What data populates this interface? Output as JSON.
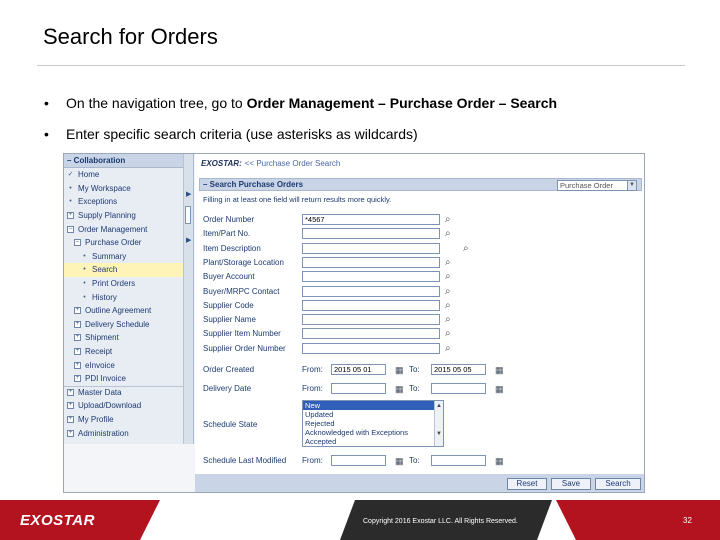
{
  "slide": {
    "title": "Search for Orders",
    "bullets": [
      {
        "plain": "On the navigation tree, go to ",
        "bold": "Order Management – Purchase Order – Search"
      },
      {
        "plain": "Enter specific search criteria (use asterisks as wildcards)",
        "bold": ""
      }
    ],
    "bullet_glyph": "•"
  },
  "nav": {
    "header": "– Collaboration",
    "items": [
      {
        "label": "Home",
        "icon": "check-icon",
        "glyph": "✓",
        "selected": false
      },
      {
        "label": "My Workspace",
        "icon": "dot-icon",
        "glyph": "•",
        "selected": false
      },
      {
        "label": "Exceptions",
        "icon": "dot-icon",
        "glyph": "•",
        "selected": false
      },
      {
        "label": "Supply Planning",
        "icon": "expand-icon",
        "glyph": "+",
        "selected": false
      },
      {
        "label": "Order Management",
        "icon": "collapse-icon",
        "glyph": "–",
        "selected": false
      },
      {
        "label": "Purchase Order",
        "icon": "collapse-icon",
        "glyph": "–",
        "selected": false,
        "indent": 1
      },
      {
        "label": "Summary",
        "icon": "dot-icon",
        "glyph": "•",
        "selected": false,
        "indent": 2
      },
      {
        "label": "Search",
        "icon": "dot-icon",
        "glyph": "•",
        "selected": true,
        "indent": 2
      },
      {
        "label": "Print Orders",
        "icon": "dot-icon",
        "glyph": "•",
        "selected": false,
        "indent": 2
      },
      {
        "label": "History",
        "icon": "dot-icon",
        "glyph": "•",
        "selected": false,
        "indent": 2
      },
      {
        "label": "Outline Agreement",
        "icon": "expand-icon",
        "glyph": "+",
        "selected": false,
        "indent": 1
      },
      {
        "label": "Delivery Schedule",
        "icon": "expand-icon",
        "glyph": "+",
        "selected": false,
        "indent": 1
      },
      {
        "label": "Shipment",
        "icon": "expand-icon",
        "glyph": "+",
        "selected": false,
        "indent": 1
      },
      {
        "label": "Receipt",
        "icon": "expand-icon",
        "glyph": "+",
        "selected": false,
        "indent": 1
      },
      {
        "label": "eInvoice",
        "icon": "expand-icon",
        "glyph": "+",
        "selected": false,
        "indent": 1
      },
      {
        "label": "PDI Invoice",
        "icon": "expand-icon",
        "glyph": "+",
        "selected": false,
        "indent": 1
      },
      {
        "label": "Master Data",
        "icon": "expand-icon",
        "glyph": "+",
        "selected": false,
        "topborder": true
      },
      {
        "label": "Upload/Download",
        "icon": "expand-icon",
        "glyph": "+",
        "selected": false
      },
      {
        "label": "My Profile",
        "icon": "expand-icon",
        "glyph": "+",
        "selected": false
      },
      {
        "label": "Administration",
        "icon": "expand-icon",
        "glyph": "+",
        "selected": false
      }
    ]
  },
  "main": {
    "logo": "EXOSTAR:",
    "breadcrumb": "<< Purchase Order Search",
    "panel_title": "– Search Purchase Orders",
    "order_type": "Purchase Order",
    "instructions": "Filling in at least one field will return results more quickly.",
    "fields": [
      {
        "label": "Order Number",
        "value": "*4567",
        "icon": "lookup-icon"
      },
      {
        "label": "Item/Part No.",
        "value": "",
        "icon": "lookup-icon"
      },
      {
        "label": "Item Description",
        "value": "",
        "icon": "lookup-icon"
      },
      {
        "label": "Plant/Storage Location",
        "value": "",
        "icon": "lookup-icon"
      },
      {
        "label": "Buyer Account",
        "value": "",
        "icon": "lookup-icon"
      },
      {
        "label": "Buyer/MRPC Contact",
        "value": "",
        "icon": "lookup-icon"
      },
      {
        "label": "Supplier Code",
        "value": "",
        "icon": "lookup-icon"
      },
      {
        "label": "Supplier Name",
        "value": "",
        "icon": "lookup-icon"
      },
      {
        "label": "Supplier Item Number",
        "value": "",
        "icon": "lookup-icon"
      },
      {
        "label": "Supplier Order Number",
        "value": "",
        "icon": "lookup-icon"
      }
    ],
    "order_created": {
      "label": "Order Created",
      "from_label": "From:",
      "from": "2015 05 01",
      "to_label": "To:",
      "to": "2015 05 05"
    },
    "delivery_date": {
      "label": "Delivery Date",
      "from_label": "From:",
      "from": "",
      "to_label": "To:",
      "to": ""
    },
    "schedule_state": {
      "label": "Schedule State",
      "options": [
        "New",
        "Updated",
        "Rejected",
        "Acknowledged with Exceptions",
        "Accepted"
      ],
      "selected": "New"
    },
    "schedule_last_modified": {
      "label": "Schedule Last Modified",
      "from_label": "From:",
      "from": "",
      "to_label": "To:",
      "to": ""
    },
    "buttons": {
      "reset": "Reset",
      "save": "Save",
      "search": "Search"
    }
  },
  "footer": {
    "logo": "EXOSTAR",
    "copyright": "Copyright 2016 Exostar LLC. All Rights Reserved.",
    "page_number": "32"
  },
  "colors": {
    "nav_bg": "#e8edf4",
    "header_bg": "#c9d5e6",
    "text_blue": "#1d3a72",
    "selected_bg": "#fff4b8",
    "footer_red": "#b3121f",
    "footer_dark": "#2b2b2b"
  }
}
